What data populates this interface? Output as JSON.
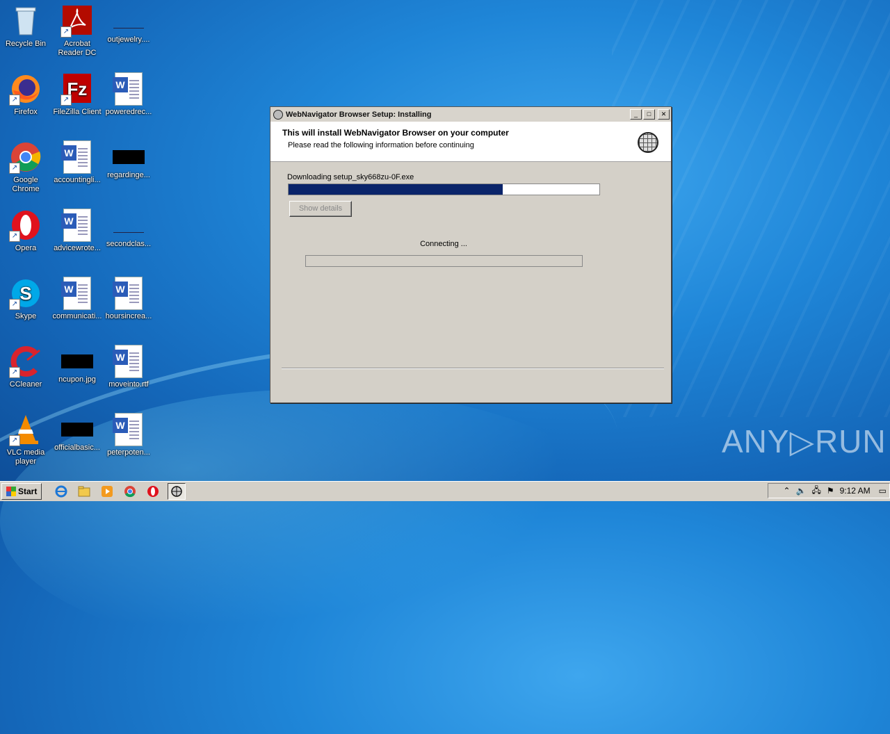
{
  "desktop": {
    "icons": [
      {
        "label": "Recycle Bin"
      },
      {
        "label": "Acrobat Reader DC"
      },
      {
        "label": "outjewelry...."
      },
      {
        "label": "Firefox"
      },
      {
        "label": "FileZilla Client"
      },
      {
        "label": "poweredrec..."
      },
      {
        "label": "Google Chrome"
      },
      {
        "label": "accountingli..."
      },
      {
        "label": "regardinge..."
      },
      {
        "label": "Opera"
      },
      {
        "label": "advicewrote..."
      },
      {
        "label": "secondclas..."
      },
      {
        "label": "Skype"
      },
      {
        "label": "communicati..."
      },
      {
        "label": "hoursincrea..."
      },
      {
        "label": "CCleaner"
      },
      {
        "label": "ncupon.jpg"
      },
      {
        "label": "moveinto.rtf"
      },
      {
        "label": "VLC media player"
      },
      {
        "label": "officialbasic..."
      },
      {
        "label": "peterpoten..."
      }
    ]
  },
  "window": {
    "title": "WebNavigator Browser Setup: Installing",
    "header_title": "This will install WebNavigator Browser on your computer",
    "header_subtitle": "Please read the following information before continuing",
    "download_label": "Downloading setup_sky668zu-0F.exe",
    "download_progress": 0.69,
    "show_details_label": "Show details",
    "status_text": "Connecting ...",
    "secondary_progress": 0
  },
  "taskbar": {
    "start_label": "Start",
    "clock": "9:12 AM"
  },
  "watermark": "ANY▷RUN"
}
